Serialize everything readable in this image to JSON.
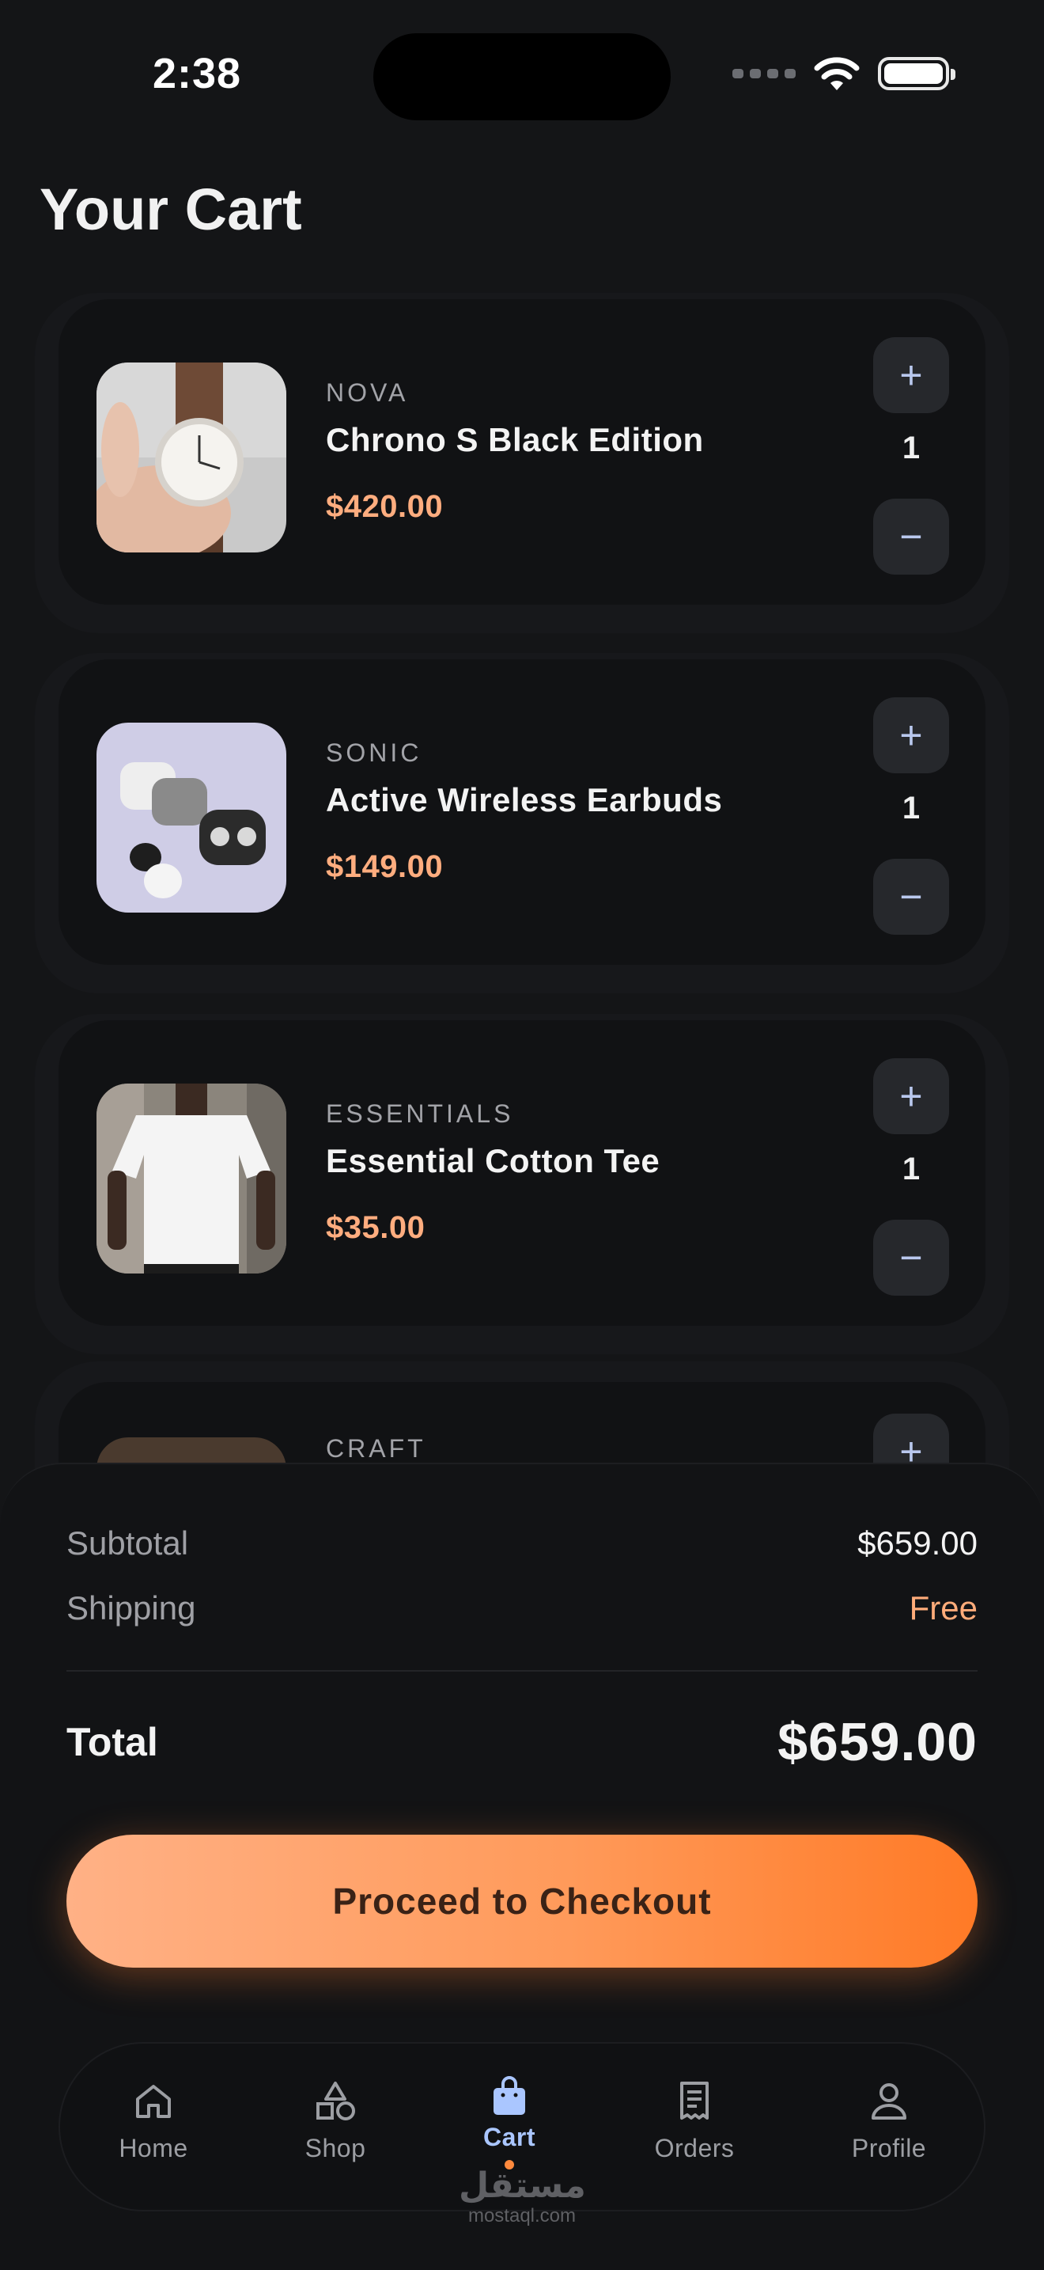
{
  "status_bar": {
    "time": "2:38"
  },
  "page": {
    "title": "Your Cart"
  },
  "cart": {
    "items": [
      {
        "brand": "NOVA",
        "name": "Chrono S Black Edition",
        "price": "$420.00",
        "quantity": "1"
      },
      {
        "brand": "SONIC",
        "name": "Active Wireless Earbuds",
        "price": "$149.00",
        "quantity": "1"
      },
      {
        "brand": "ESSENTIALS",
        "name": "Essential Cotton Tee",
        "price": "$35.00",
        "quantity": "1"
      },
      {
        "brand": "CRAFT",
        "name": "",
        "price": "",
        "quantity": ""
      }
    ],
    "plus_symbol": "+",
    "minus_symbol": "−"
  },
  "summary": {
    "subtotal_label": "Subtotal",
    "subtotal_value": "$659.00",
    "shipping_label": "Shipping",
    "shipping_value": "Free",
    "total_label": "Total",
    "total_value": "$659.00",
    "checkout_label": "Proceed to Checkout"
  },
  "tab_bar": {
    "tabs": [
      {
        "label": "Home",
        "icon": "home-icon"
      },
      {
        "label": "Shop",
        "icon": "shapes-icon"
      },
      {
        "label": "Cart",
        "icon": "shopping-bag-icon"
      },
      {
        "label": "Orders",
        "icon": "receipt-icon"
      },
      {
        "label": "Profile",
        "icon": "person-icon"
      }
    ],
    "active": "Cart"
  },
  "watermark": {
    "arabic": "مستقل",
    "latin": "mostaql.com"
  },
  "colors": {
    "background": "#141517",
    "card": "#111214",
    "price_accent": "#ffad7f",
    "active_tab": "#aac6ff",
    "checkout_gradient_start": "#ffb186",
    "checkout_gradient_end": "#ff7a26"
  }
}
